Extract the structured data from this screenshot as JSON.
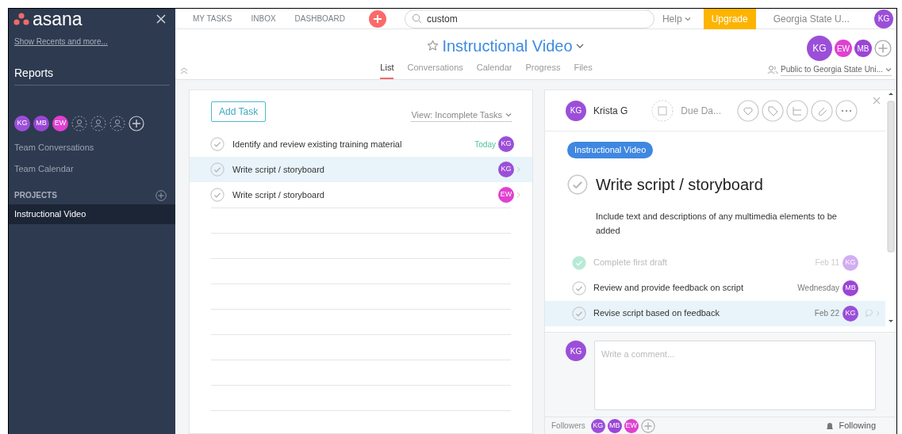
{
  "sidebar": {
    "logo": "asana",
    "show_recents": "Show Recents and more...",
    "section_title": "Reports",
    "members": [
      {
        "initials": "KG",
        "color": "#9b4fd9"
      },
      {
        "initials": "MB",
        "color": "#9b45d6"
      },
      {
        "initials": "EW",
        "color": "#e040d0"
      }
    ],
    "links": [
      "Team Conversations",
      "Team Calendar"
    ],
    "projects_heading": "PROJECTS",
    "projects": [
      {
        "label": "Instructional Video",
        "selected": true
      }
    ]
  },
  "topbar": {
    "nav": [
      "MY TASKS",
      "INBOX",
      "DASHBOARD"
    ],
    "search": {
      "value": "custom"
    },
    "help": "Help",
    "upgrade": "Upgrade",
    "org": "Georgia State U...",
    "user": {
      "initials": "KG",
      "color": "#9b4fd9"
    }
  },
  "project": {
    "title": "Instructional Video",
    "tabs": [
      {
        "label": "List",
        "selected": true
      },
      {
        "label": "Conversations",
        "selected": false
      },
      {
        "label": "Calendar",
        "selected": false
      },
      {
        "label": "Progress",
        "selected": false
      },
      {
        "label": "Files",
        "selected": false
      }
    ],
    "members": [
      {
        "initials": "KG",
        "color": "#9b4fd9"
      },
      {
        "initials": "EW",
        "color": "#e040d0"
      },
      {
        "initials": "MB",
        "color": "#9b45d6"
      }
    ],
    "privacy": "Public to Georgia State Uni..."
  },
  "task_list": {
    "add_task": "Add Task",
    "view": "View: Incomplete Tasks",
    "tasks": [
      {
        "name": "Identify and review existing training material",
        "due": "Today",
        "selected": false,
        "assignee": {
          "initials": "KG",
          "color": "#9b4fd9"
        }
      },
      {
        "name": "Write script / storyboard",
        "selected": true,
        "assignee": {
          "initials": "KG",
          "color": "#9b4fd9"
        }
      },
      {
        "name": "Write script / storyboard",
        "selected": false,
        "assignee": {
          "initials": "EW",
          "color": "#e040d0"
        }
      }
    ]
  },
  "detail": {
    "assignee": {
      "initials": "KG",
      "color": "#9b4fd9",
      "name": "Krista G"
    },
    "due": "Due Da...",
    "tag": "Instructional Video",
    "title": "Write script / storyboard",
    "description": "Include text and descriptions of any multimedia elements to be added",
    "subtasks": [
      {
        "name": "Complete first draft",
        "due": "Feb 11",
        "completed": true,
        "selected": false,
        "assignee": {
          "initials": "KG",
          "color": "#d2adf2"
        }
      },
      {
        "name": "Review and provide feedback on script",
        "due": "Wednesday",
        "completed": false,
        "selected": false,
        "assignee": {
          "initials": "MB",
          "color": "#9b45d6"
        }
      },
      {
        "name": "Revise script based on feedback",
        "due": "Feb 22",
        "completed": false,
        "selected": true,
        "assignee": {
          "initials": "KG",
          "color": "#9b4fd9"
        }
      }
    ],
    "commenter": {
      "initials": "KG",
      "color": "#9b4fd9"
    },
    "comment": {
      "placeholder": "Write a comment..."
    },
    "followers_label": "Followers",
    "followers": [
      {
        "initials": "KG",
        "color": "#9b4fd9"
      },
      {
        "initials": "MB",
        "color": "#9b45d6"
      },
      {
        "initials": "EW",
        "color": "#e040d0"
      }
    ],
    "following": "Following"
  }
}
